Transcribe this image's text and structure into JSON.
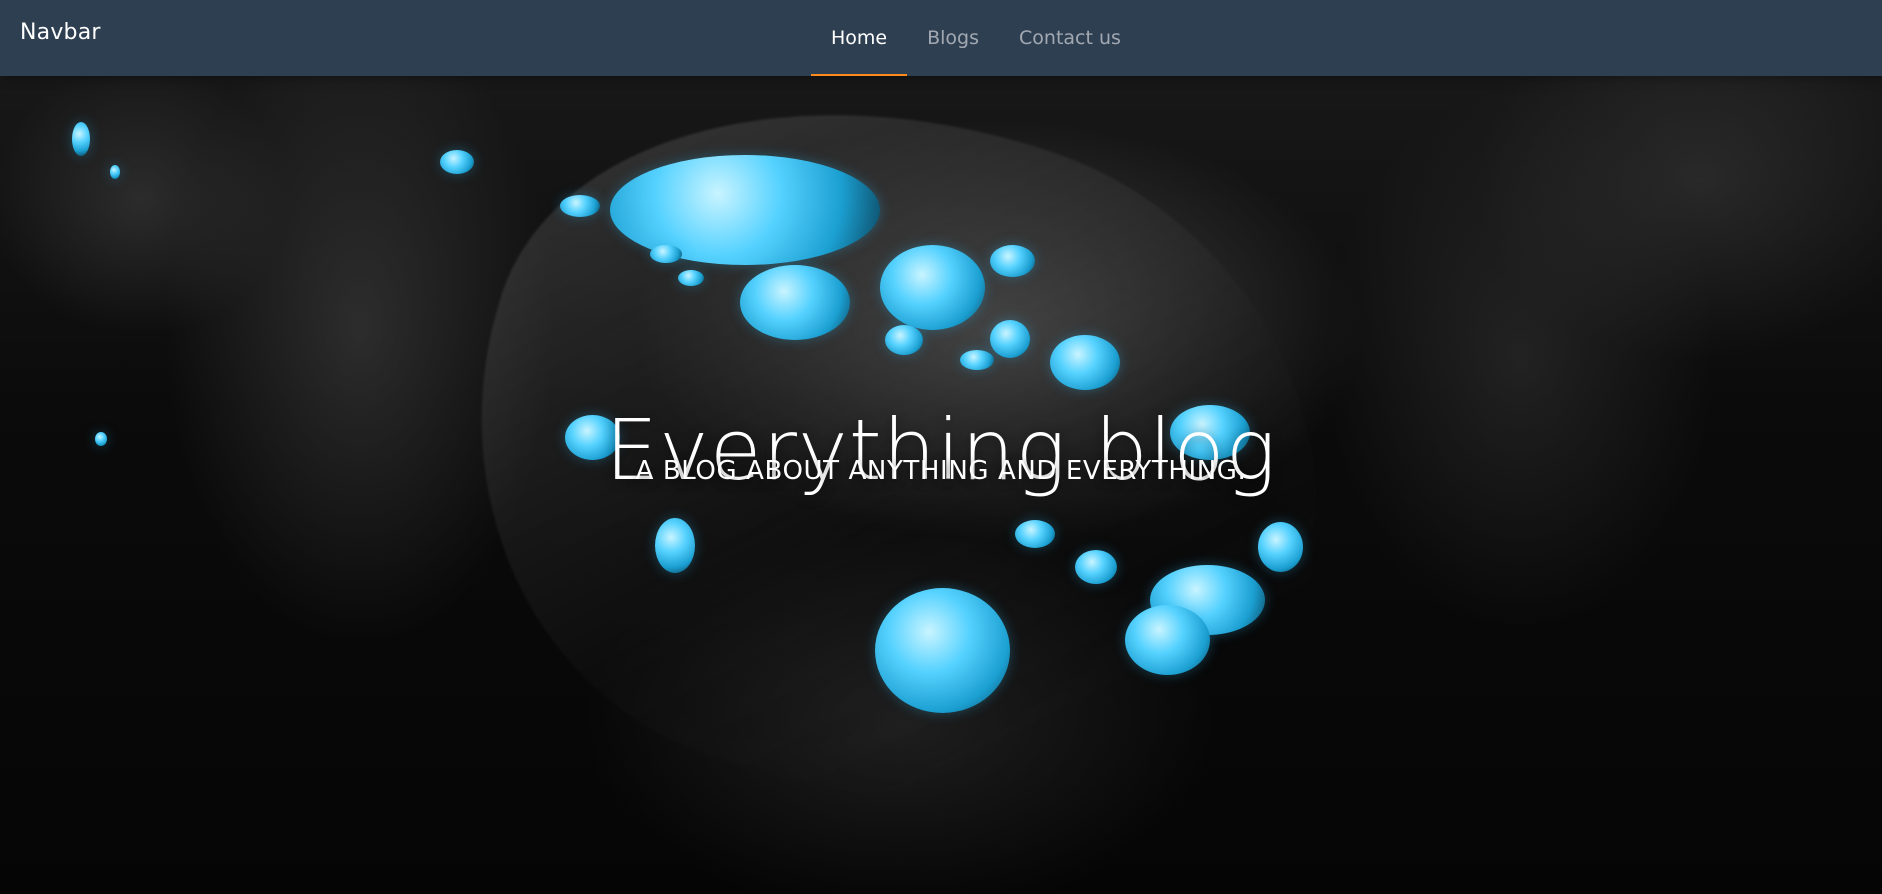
{
  "navbar": {
    "brand": "Navbar",
    "links": [
      {
        "label": "Home",
        "active": true
      },
      {
        "label": "Blogs",
        "active": false
      },
      {
        "label": "Contact us",
        "active": false
      }
    ],
    "background_color": "#2f3f52",
    "active_underline_color": "#ff8c1a"
  },
  "hero": {
    "title": "Everything blog",
    "subtitle": "A BLOG ABOUT ANYTHING AND EVERYTHING.",
    "background_image_name": "blue-water-droplets-on-dark-leaf"
  }
}
